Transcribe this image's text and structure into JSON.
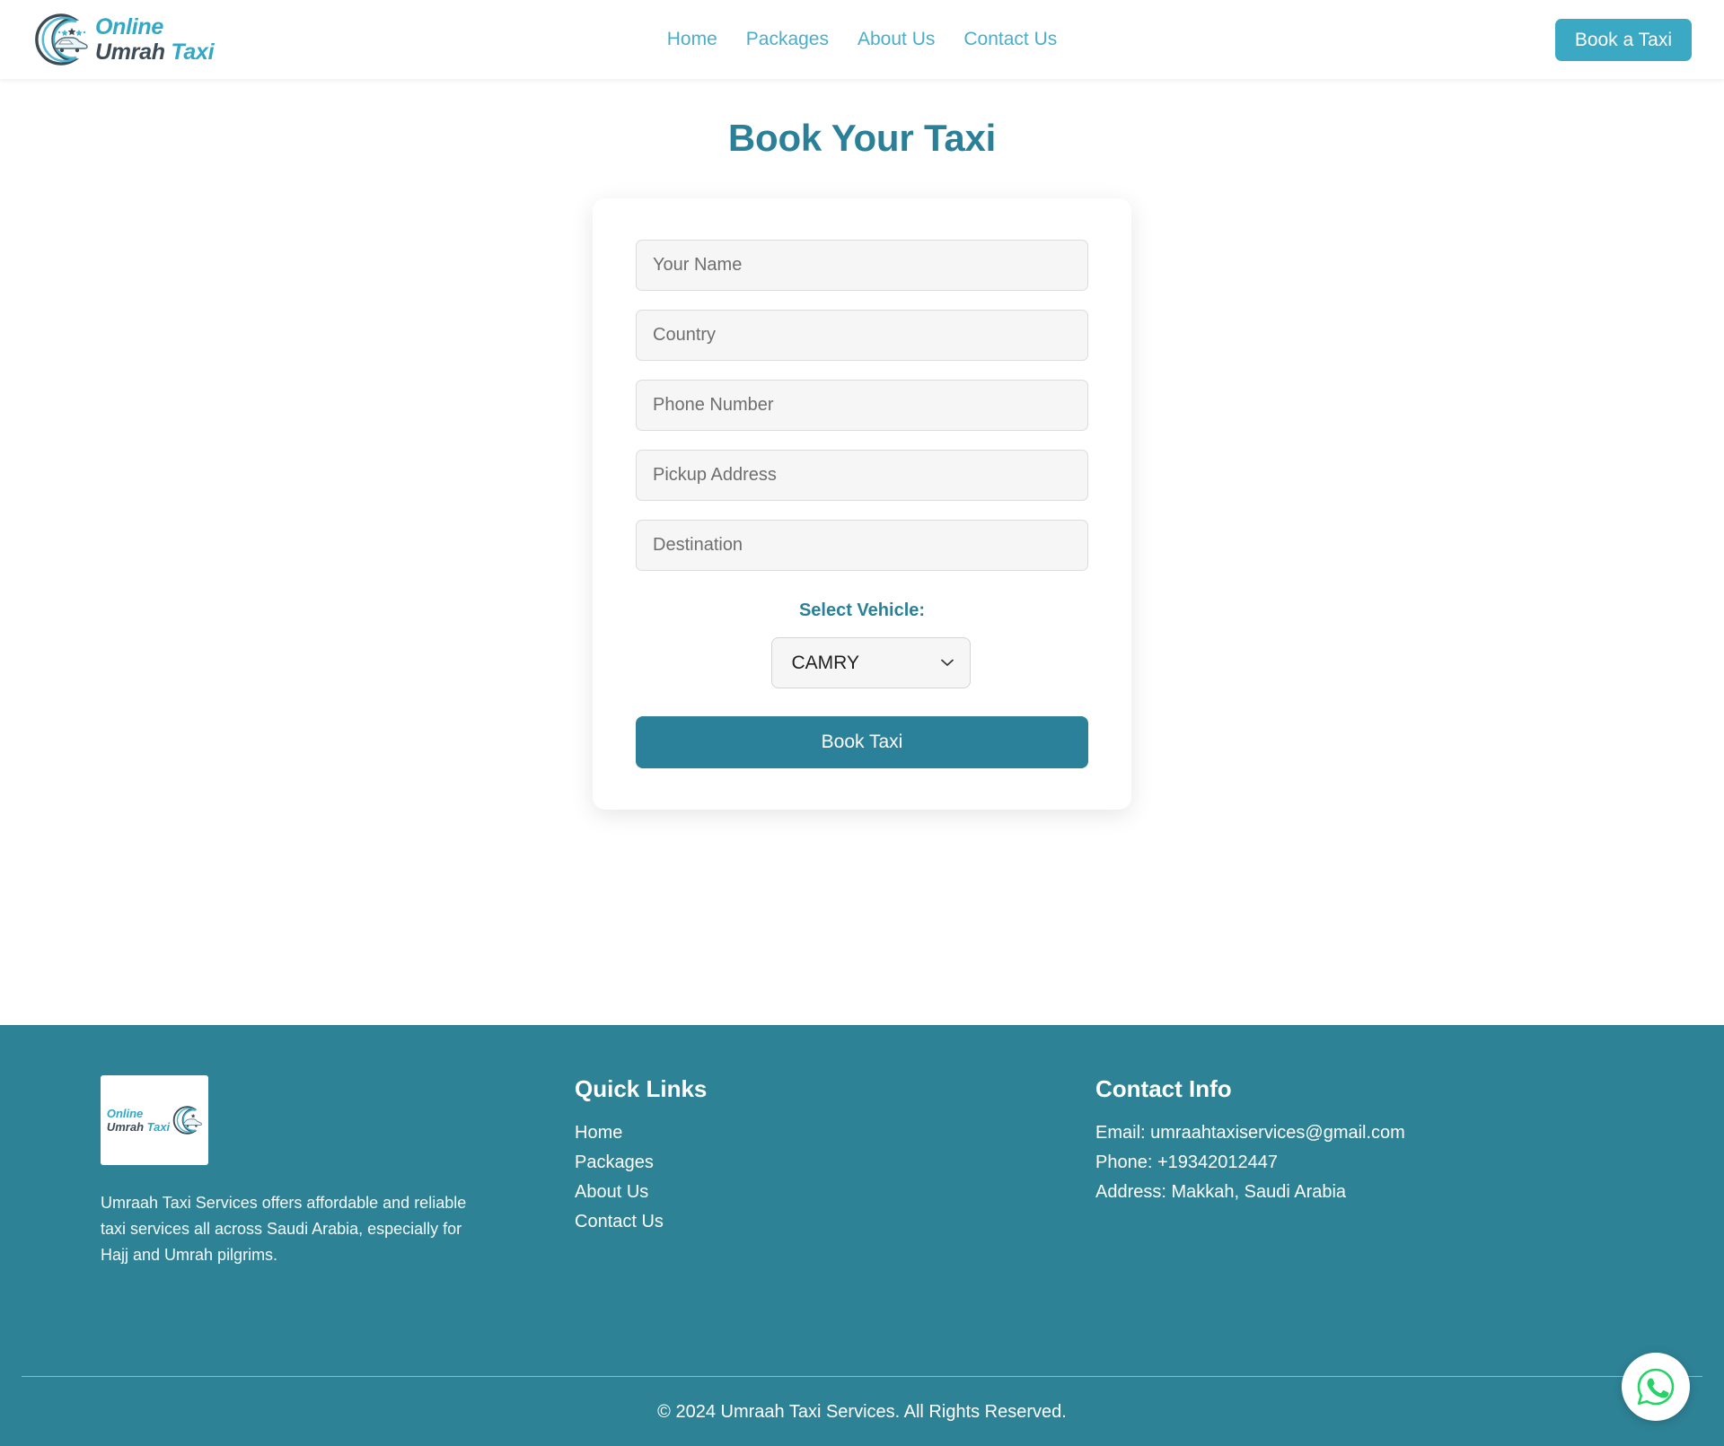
{
  "brand": {
    "line1": "Online",
    "line2_dark": "Umrah",
    "line2_accent": "Taxi",
    "logo_icon": "crescent-moon-car-icon"
  },
  "header": {
    "nav": [
      {
        "label": "Home"
      },
      {
        "label": "Packages"
      },
      {
        "label": "About Us"
      },
      {
        "label": "Contact Us"
      }
    ],
    "cta_label": "Book a Taxi"
  },
  "main": {
    "title": "Book Your Taxi",
    "form": {
      "fields": [
        {
          "name": "your-name",
          "placeholder": "Your Name",
          "value": ""
        },
        {
          "name": "country",
          "placeholder": "Country",
          "value": ""
        },
        {
          "name": "phone-number",
          "placeholder": "Phone Number",
          "value": ""
        },
        {
          "name": "pickup-address",
          "placeholder": "Pickup Address",
          "value": ""
        },
        {
          "name": "destination",
          "placeholder": "Destination",
          "value": ""
        }
      ],
      "vehicle_label": "Select Vehicle:",
      "vehicle_selected": "CAMRY",
      "vehicle_options": [
        "CAMRY"
      ],
      "submit_label": "Book Taxi"
    }
  },
  "footer": {
    "logo_alt": "Online Umrah Taxi",
    "about_text": "Umraah Taxi Services offers affordable and reliable taxi services all across Saudi Arabia, especially for Hajj and Umrah pilgrims.",
    "quick_links_heading": "Quick Links",
    "quick_links": [
      {
        "label": "Home"
      },
      {
        "label": "Packages"
      },
      {
        "label": "About Us"
      },
      {
        "label": "Contact Us"
      }
    ],
    "contact_heading": "Contact Info",
    "contact_lines": [
      {
        "text": "Email: umraahtaxiservices@gmail.com"
      },
      {
        "text": "Phone: +19342012447"
      },
      {
        "text": "Address: Makkah, Saudi Arabia"
      }
    ],
    "copyright": "© 2024 Umraah Taxi Services. All Rights Reserved."
  },
  "floating": {
    "whatsapp_icon": "whatsapp-icon"
  },
  "colors": {
    "brand_accent": "#33a8c6",
    "nav_link": "#4aaec9",
    "header_cta_bg": "#3ba8c4",
    "title_teal": "#2b8099",
    "footer_bg": "#2e8296",
    "button_teal": "#2b809a",
    "whatsapp_green": "#25D366"
  }
}
